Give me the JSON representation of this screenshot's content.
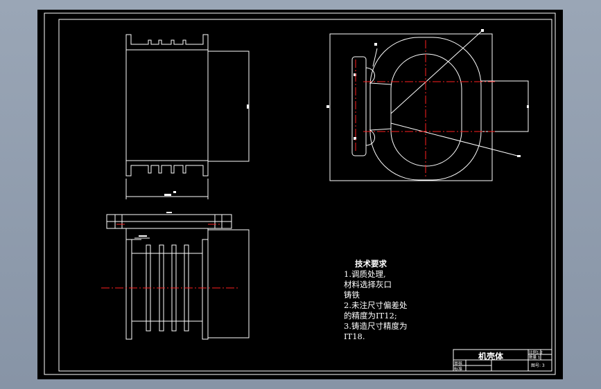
{
  "title_block": {
    "part_name": "机壳体",
    "row_labels": [
      "审核",
      "标准"
    ],
    "right_top": "比例1:2",
    "right_mid": "数量 1",
    "sheet": "图号: 3"
  },
  "tech_notes": {
    "title": "技术要求",
    "lines": [
      "1.调质处理,",
      "材料选择灰口",
      "铸铁",
      "2.未注尺寸偏差处",
      "的精度为IT12;",
      "3.铸造尺寸精度为",
      "IT18."
    ]
  },
  "colors": {
    "background": "#000000",
    "line": "#ffffff",
    "centerline": "#ff2020",
    "outer_frame": "#8a97a8"
  }
}
